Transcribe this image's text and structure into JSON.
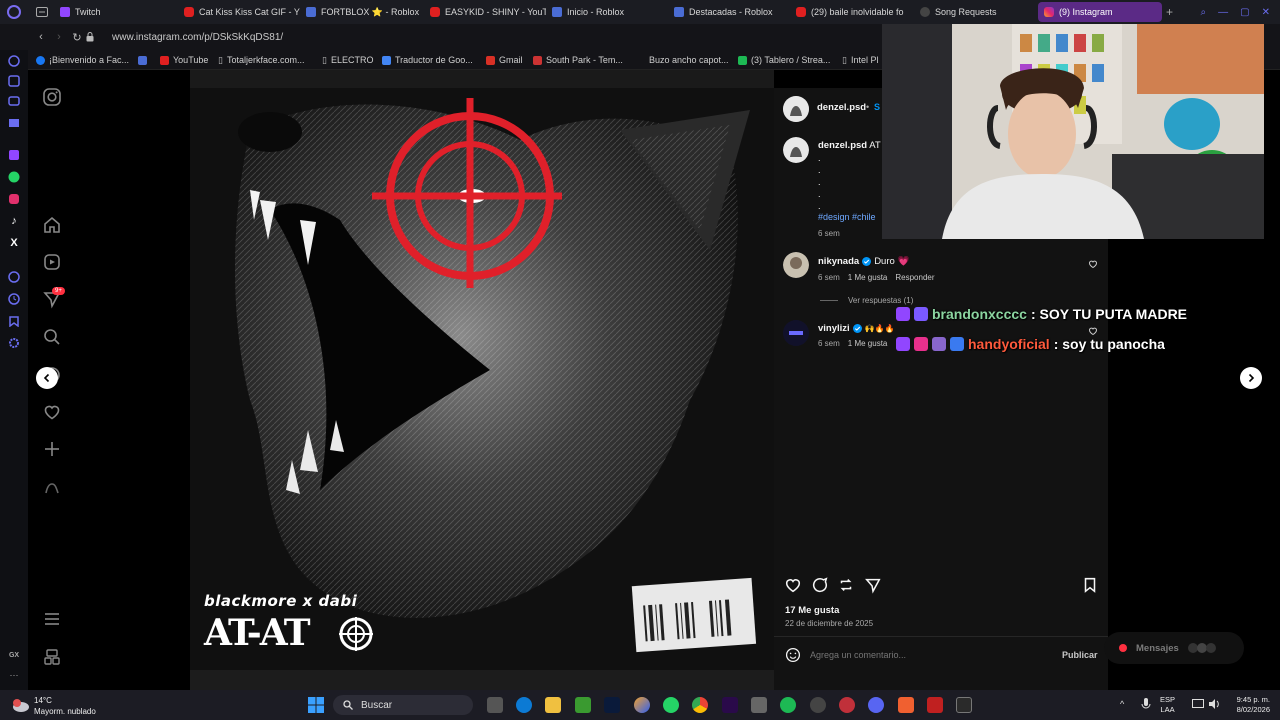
{
  "tabs": [
    {
      "label": "Twitch",
      "icon": "twitch-icon"
    },
    {
      "label": "Cat Kiss Kiss Cat GIF - Y",
      "icon": "youtube-icon"
    },
    {
      "label": "FORTBLOX ⭐ - Roblox",
      "icon": "roblox-icon"
    },
    {
      "label": "EASYKID - SHINY - YouT",
      "icon": "youtube-icon"
    },
    {
      "label": "Inicio - Roblox",
      "icon": "roblox-icon"
    },
    {
      "label": "Destacadas - Roblox",
      "icon": "roblox-icon"
    },
    {
      "label": "(29) baile inolvidable fo",
      "icon": "youtube-icon"
    },
    {
      "label": "Song Requests",
      "icon": "music-icon"
    },
    {
      "label": "(9) Instagram",
      "icon": "instagram-icon"
    }
  ],
  "address": {
    "url": "www.instagram.com/p/DSkSkKqDS81/"
  },
  "bookmarks": [
    {
      "label": "¡Bienvenido a Fac..."
    },
    {
      "label": ""
    },
    {
      "label": "YouTube"
    },
    {
      "label": "Totaljerkface.com..."
    },
    {
      "label": "ELECTRO"
    },
    {
      "label": "Traductor de Goo..."
    },
    {
      "label": "Gmail"
    },
    {
      "label": "South Park - Tem..."
    },
    {
      "label": "Buzo ancho capot..."
    },
    {
      "label": "(3) Tablero / Strea..."
    },
    {
      "label": "Intel Pl"
    }
  ],
  "opera_sidebar": {
    "notification_badge": "9+"
  },
  "post": {
    "author": "denzel.psd",
    "follow_hint": "S",
    "caption_author": "denzel.psd",
    "caption_text": "AT",
    "caption_dots": [
      ".",
      ".",
      ".",
      ".",
      "."
    ],
    "hashtags": "#design #chile",
    "caption_time": "6 sem",
    "artwork_text": "blackmore x dabi",
    "artwork_logo": "AT-AT",
    "likes": "17 Me gusta",
    "date": "22 de diciembre de 2025",
    "comment_placeholder": "Agrega un comentario...",
    "publish_label": "Publicar"
  },
  "comments": [
    {
      "user": "nikynada",
      "verified": true,
      "text": "Duro",
      "emoji": "💗",
      "time": "6 sem",
      "likes": "1 Me gusta",
      "reply": "Responder"
    },
    {
      "user": "vinylizi",
      "verified": true,
      "text": "🙌🔥🔥",
      "time": "6 sem",
      "likes": "1 Me gusta",
      "reply": ""
    }
  ],
  "view_replies": "Ver respuestas (1)",
  "messages_label": "Mensajes",
  "chat": [
    {
      "user": "brandonxcccc",
      "message": ": SOY TU PUTA MADRE",
      "color": "#8bd5a0"
    },
    {
      "user": "handyoficial",
      "message": ": soy tu panocha",
      "color": "#ff5a3c"
    }
  ],
  "taskbar": {
    "weather_temp": "14°C",
    "weather_desc": "Mayorm. nublado",
    "search_label": "Buscar",
    "lang_top": "ESP",
    "lang_bottom": "LAA",
    "time": "9:45 p. m.",
    "date": "8/02/2026"
  },
  "colors": {
    "accent_tab": "#5b2a86",
    "ig_blue": "#0095f6",
    "crosshair": "#e0202a"
  }
}
